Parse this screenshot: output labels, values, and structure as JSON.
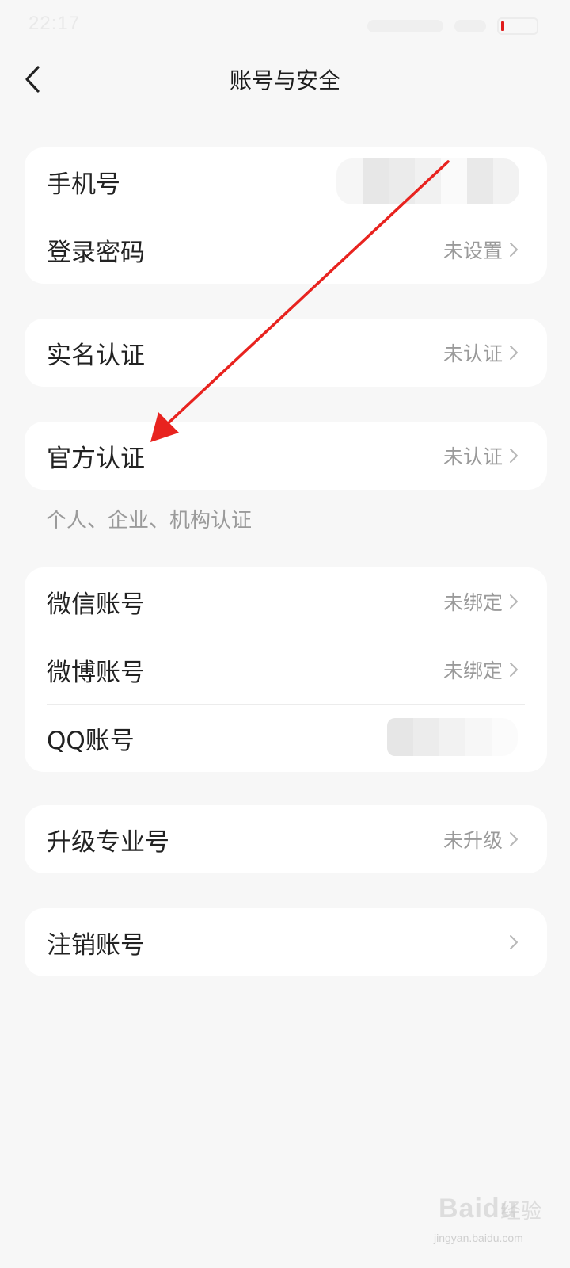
{
  "status_bar": {
    "time": "22:17",
    "battery_level": 0.05
  },
  "nav": {
    "title": "账号与安全"
  },
  "groups": {
    "account": {
      "phone_label": "手机号",
      "password_label": "登录密码",
      "password_value": "未设置"
    },
    "real_name": {
      "label": "实名认证",
      "value": "未认证"
    },
    "official": {
      "label": "官方认证",
      "value": "未认证",
      "note": "个人、企业、机构认证"
    },
    "bindings": {
      "wechat_label": "微信账号",
      "wechat_value": "未绑定",
      "weibo_label": "微博账号",
      "weibo_value": "未绑定",
      "qq_label": "QQ账号"
    },
    "pro": {
      "label": "升级专业号",
      "value": "未升级"
    },
    "cancel": {
      "label": "注销账号"
    }
  },
  "watermark": {
    "brand": "Baidu",
    "product": "经验",
    "url": "jingyan.baidu.com"
  },
  "colors": {
    "background": "#f7f7f7",
    "card": "#ffffff",
    "secondary_text": "#9a9a9a",
    "annotation_arrow": "#e8231f"
  },
  "icons": [
    "chevron-left-icon",
    "chevron-right-icon",
    "battery-icon"
  ]
}
